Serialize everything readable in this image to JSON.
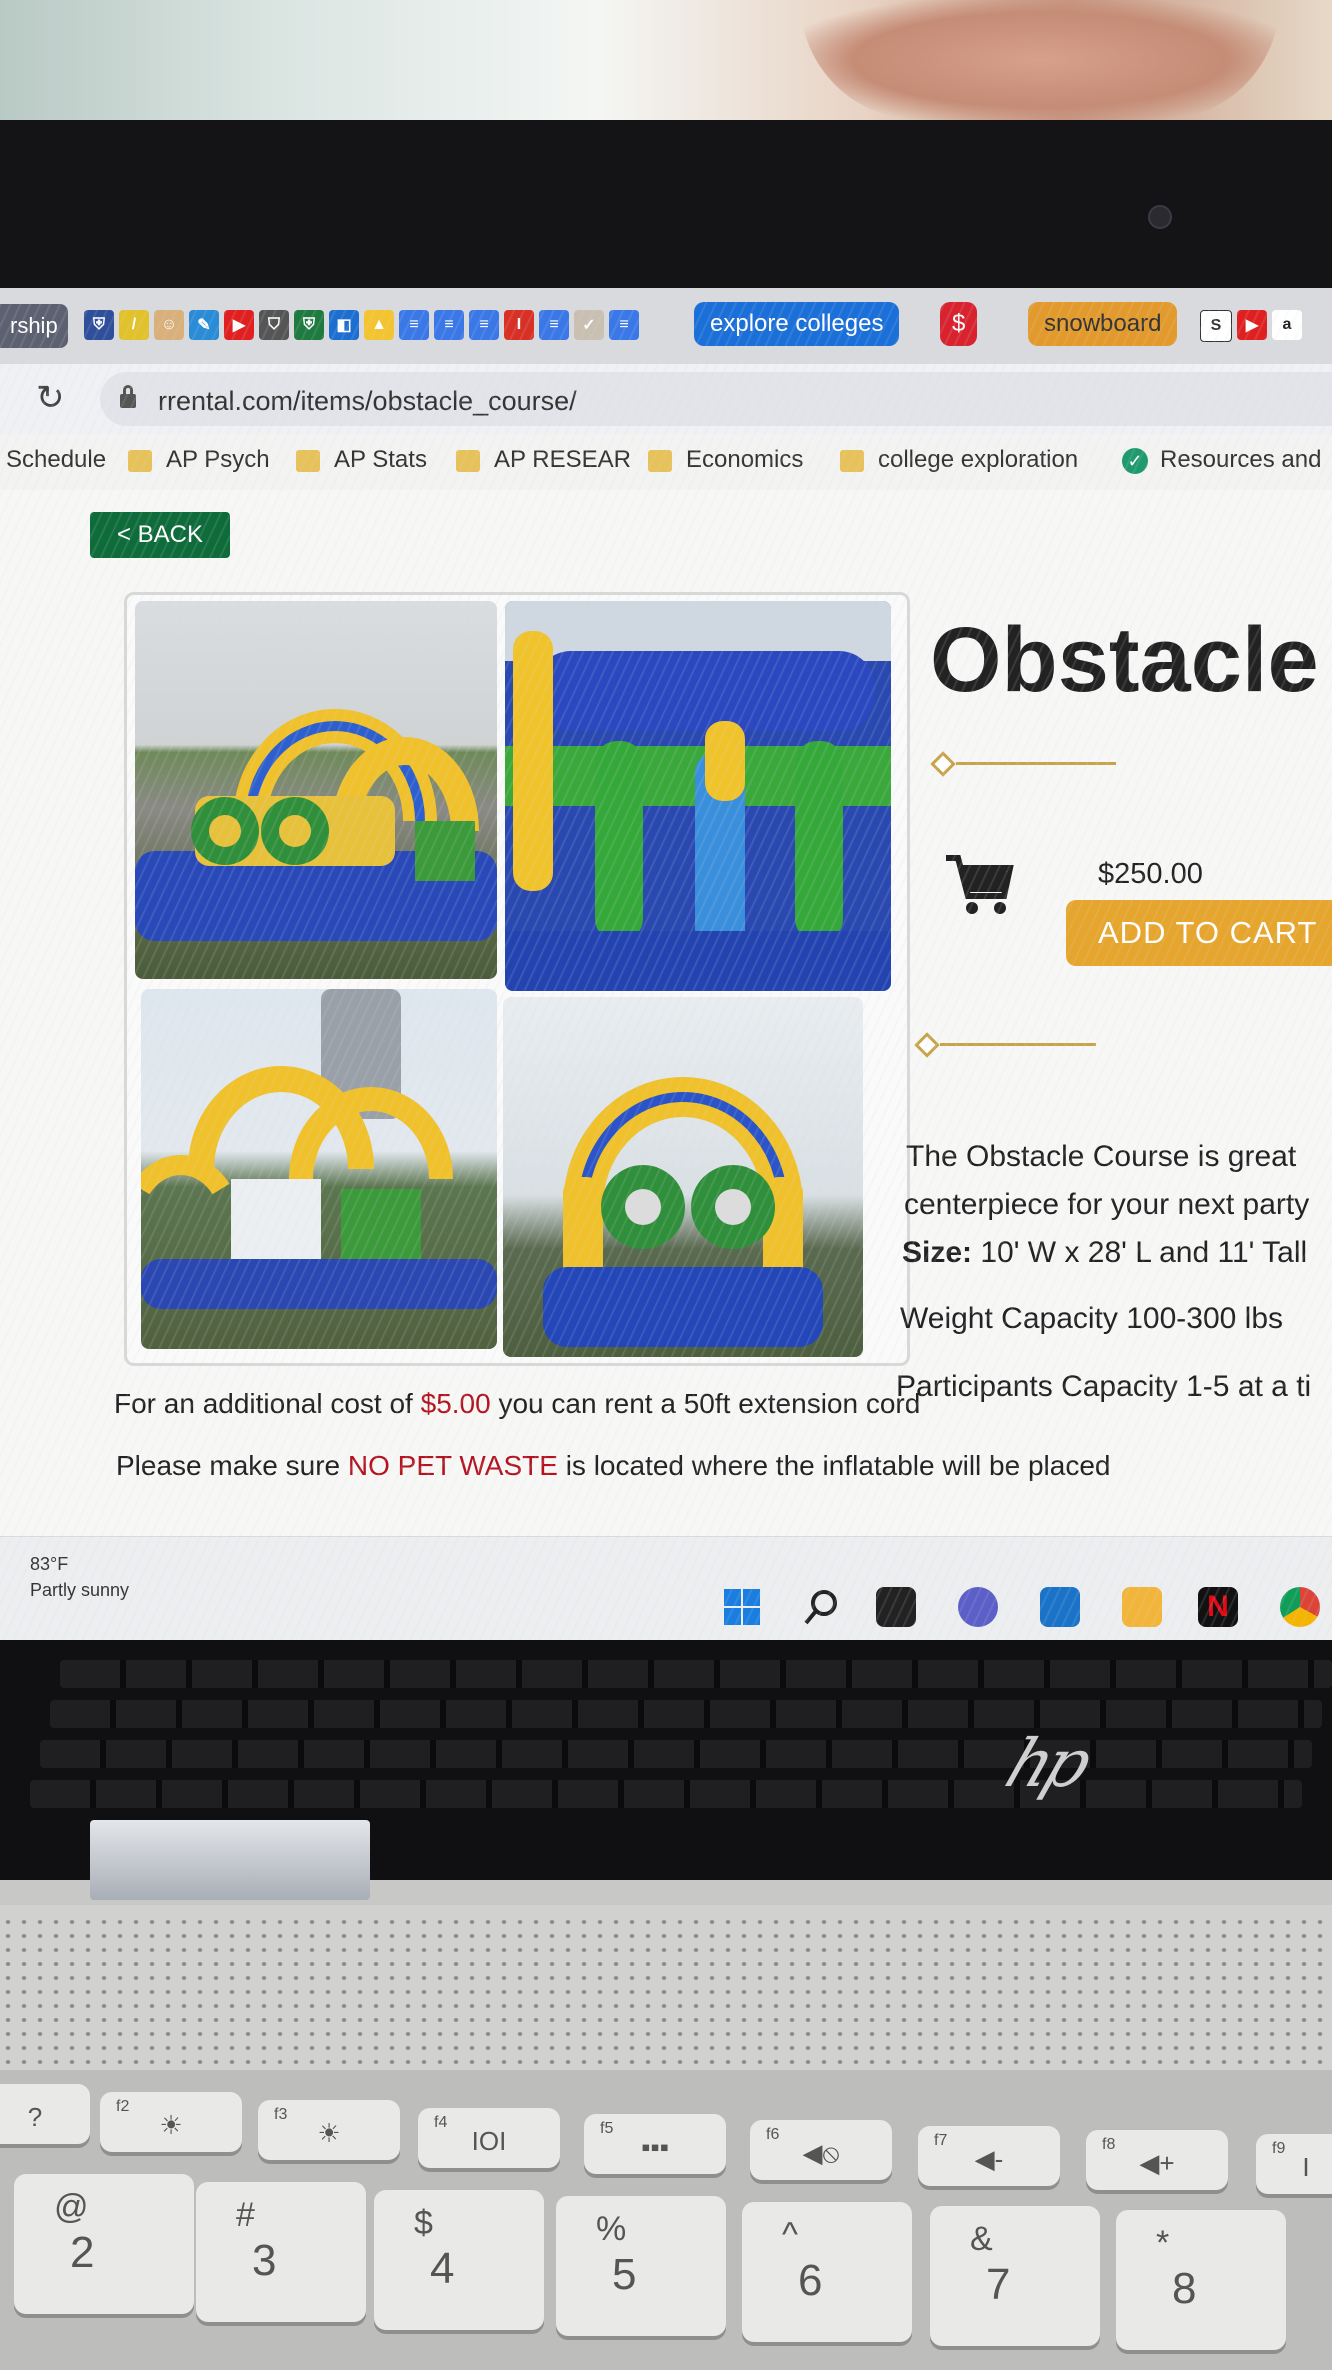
{
  "browser": {
    "first_tab_label": "rship",
    "tab_groups": [
      {
        "label": "explore colleges",
        "color": "#1a6fd8"
      },
      {
        "label": "$",
        "color": "#d8232f"
      },
      {
        "label": "snowboard",
        "color": "#e39a2c"
      }
    ],
    "url": "rrental.com/items/obstacle_course/",
    "bookmarks": [
      "Schedule",
      "AP Psych",
      "AP Stats",
      "AP RESEAR",
      "Economics",
      "college exploration",
      "Resources and"
    ]
  },
  "page": {
    "back_label": "< BACK",
    "title": "Obstacle",
    "price": "$250.00",
    "add_to_cart_label": "ADD TO CART",
    "description_line1": "The Obstacle Course is great",
    "description_line2": "centerpiece for your next party",
    "size_label": "Size:",
    "size_value": " 10' W x 28' L and 11' Tall",
    "weight": "Weight Capacity 100-300 lbs",
    "participants": "Participants Capacity 1-5 at a ti",
    "cord_prefix": "For an additional cost of ",
    "cord_price": "$5.00",
    "cord_suffix": " you can rent a 50ft extension cord",
    "pet_prefix": "Please make sure ",
    "pet_highlight": "NO PET WASTE",
    "pet_suffix": " is located where the inflatable will be placed"
  },
  "taskbar": {
    "temperature": "83°F",
    "condition": "Partly sunny"
  },
  "keyboard": {
    "fn_keys": [
      {
        "small": "",
        "symbol": "?"
      },
      {
        "small": "f2",
        "symbol": "☀"
      },
      {
        "small": "f3",
        "symbol": "☀"
      },
      {
        "small": "f4",
        "symbol": "IOI"
      },
      {
        "small": "f5",
        "symbol": "▪▪▪"
      },
      {
        "small": "f6",
        "symbol": "◀⦸"
      },
      {
        "small": "f7",
        "symbol": "◀-"
      },
      {
        "small": "f8",
        "symbol": "◀+"
      },
      {
        "small": "f9",
        "symbol": "I"
      }
    ],
    "num_keys": [
      {
        "top": "@",
        "bottom": "2"
      },
      {
        "top": "#",
        "bottom": "3"
      },
      {
        "top": "$",
        "bottom": "4"
      },
      {
        "top": "%",
        "bottom": "5"
      },
      {
        "top": "^",
        "bottom": "6"
      },
      {
        "top": "&",
        "bottom": "7"
      },
      {
        "top": "*",
        "bottom": "8"
      }
    ],
    "brand": "hp"
  },
  "colors": {
    "back_button": "#0e6b3a",
    "add_to_cart": "#e6a52c",
    "highlight_red": "#b3121e",
    "divider_gold": "#c9a34a"
  }
}
